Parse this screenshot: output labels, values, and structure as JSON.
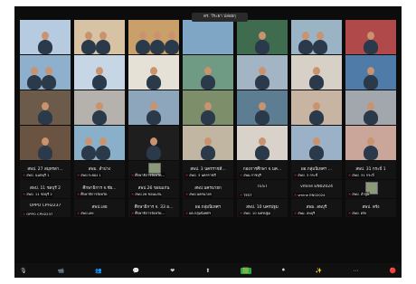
{
  "speaker_label": "ดร. วีระยา ปล่อยกุ",
  "video_tiles": [
    {
      "label": "",
      "bg": "#b6cbe0",
      "people": 1
    },
    {
      "label": "",
      "bg": "#d8c2a4",
      "people": 2
    },
    {
      "label": "",
      "bg": "#c9a06a",
      "people": 3
    },
    {
      "label": "",
      "bg": "#7fa6c4",
      "people": 0
    },
    {
      "label": "",
      "bg": "#3f6b4f",
      "people": 1
    },
    {
      "label": "",
      "bg": "#9ab4c6",
      "people": 2
    },
    {
      "label": "",
      "bg": "#b04a4a",
      "people": 1
    },
    {
      "label": "",
      "bg": "#8fb0cc",
      "people": 2
    },
    {
      "label": "",
      "bg": "#c7d6e4",
      "people": 1
    },
    {
      "label": "",
      "bg": "#e6e1d6",
      "people": 1
    },
    {
      "label": "",
      "bg": "#6f9a84",
      "people": 1
    },
    {
      "label": "",
      "bg": "#a3b5c4",
      "people": 1
    },
    {
      "label": "",
      "bg": "#d7d0c6",
      "people": 1
    },
    {
      "label": "",
      "bg": "#4e7ba8",
      "people": 1
    },
    {
      "label": "",
      "bg": "#6c5a4a",
      "people": 1
    },
    {
      "label": "",
      "bg": "#b5b2ad",
      "people": 1
    },
    {
      "label": "",
      "bg": "#8ea6bb",
      "people": 1
    },
    {
      "label": "",
      "bg": "#7d8f6a",
      "people": 1
    },
    {
      "label": "",
      "bg": "#5d7e92",
      "people": 1
    },
    {
      "label": "",
      "bg": "#c8b4a2",
      "people": 1
    },
    {
      "label": "",
      "bg": "#a1a7ad",
      "people": 1
    },
    {
      "label": "",
      "bg": "#6b5342",
      "people": 1
    },
    {
      "label": "",
      "bg": "#8ab0c9",
      "people": 2
    },
    {
      "label": "",
      "bg": "#1e1e1e",
      "people": 1
    },
    {
      "label": "",
      "bg": "#c0b6a2",
      "people": 1
    },
    {
      "label": "",
      "bg": "#d8d2ca",
      "people": 1
    },
    {
      "label": "",
      "bg": "#9ab1c8",
      "people": 1
    },
    {
      "label": "",
      "bg": "#caa59a",
      "people": 1
    }
  ],
  "name_tiles": [
    {
      "name": "สพป. 27 สมุทรสา...",
      "label": "สพป. นนทบุรี 1"
    },
    {
      "name": "สพม. ลำปาง",
      "label": "สพป.ระยอง 1"
    },
    {
      "name": "",
      "label": "ศึกษาธิการจังหวัด..."
    },
    {
      "name": "สพป. 3 นครราชสี...",
      "label": "สพป. 3 นครราชสี"
    },
    {
      "name": "กองการศึกษา จ.นค...",
      "label": "สพม.ราชบุรี"
    },
    {
      "name": "ผอ.กลุ่มนิเทศฯ ...",
      "label": "สพป. 3 กระบี่"
    },
    {
      "name": "สพป. 31 กระบี่ 1",
      "label": "สพป. 31 กระบี่"
    },
    {
      "name": "สพป. 11 ชลบุรี 2",
      "label": "สพป. 11 ชลบุรี 2"
    },
    {
      "name": "ศึกษาธิการ จ.ชัย...",
      "label": "ศึกษาธิการจังหวัด"
    },
    {
      "name": "สพป.26 ขอนแก่น",
      "label": "สพป.26 ขอนแก่น"
    },
    {
      "name": "สพป.นครนายก",
      "label": "สพป.นครนายก"
    },
    {
      "name": "TEST",
      "label": "TEST"
    },
    {
      "name": "vmine EN02024",
      "label": "vmine EN02024"
    },
    {
      "name": "",
      "label": "สพป. ลำพูน"
    },
    {
      "name": "OPPO CPH2237",
      "label": "OPPO CPH2237"
    },
    {
      "name": "สพป.เลย",
      "label": "สพป.เลย"
    },
    {
      "name": "ศึกษาธิการ จ. 33 อ...",
      "label": "ศึกษาธิการจังหวัด..."
    },
    {
      "name": "ผอ.กลุ่มนิเทศฯ",
      "label": "ผอ.กลุ่มนิเทศฯ"
    },
    {
      "name": "สพป. 10 นครปฐม",
      "label": "สพป. 10 นครปฐม"
    },
    {
      "name": "สพม. ลพบุรี",
      "label": "สพม. ลพบุรี"
    },
    {
      "name": "สพป. ตรัง",
      "label": "สพป. ตรัง"
    }
  ],
  "toolbar": [
    "🎙",
    "📹",
    "👥",
    "💬",
    "❤",
    "⬆",
    "🟩",
    "⏺",
    "✨",
    "⋯",
    "🔴"
  ]
}
